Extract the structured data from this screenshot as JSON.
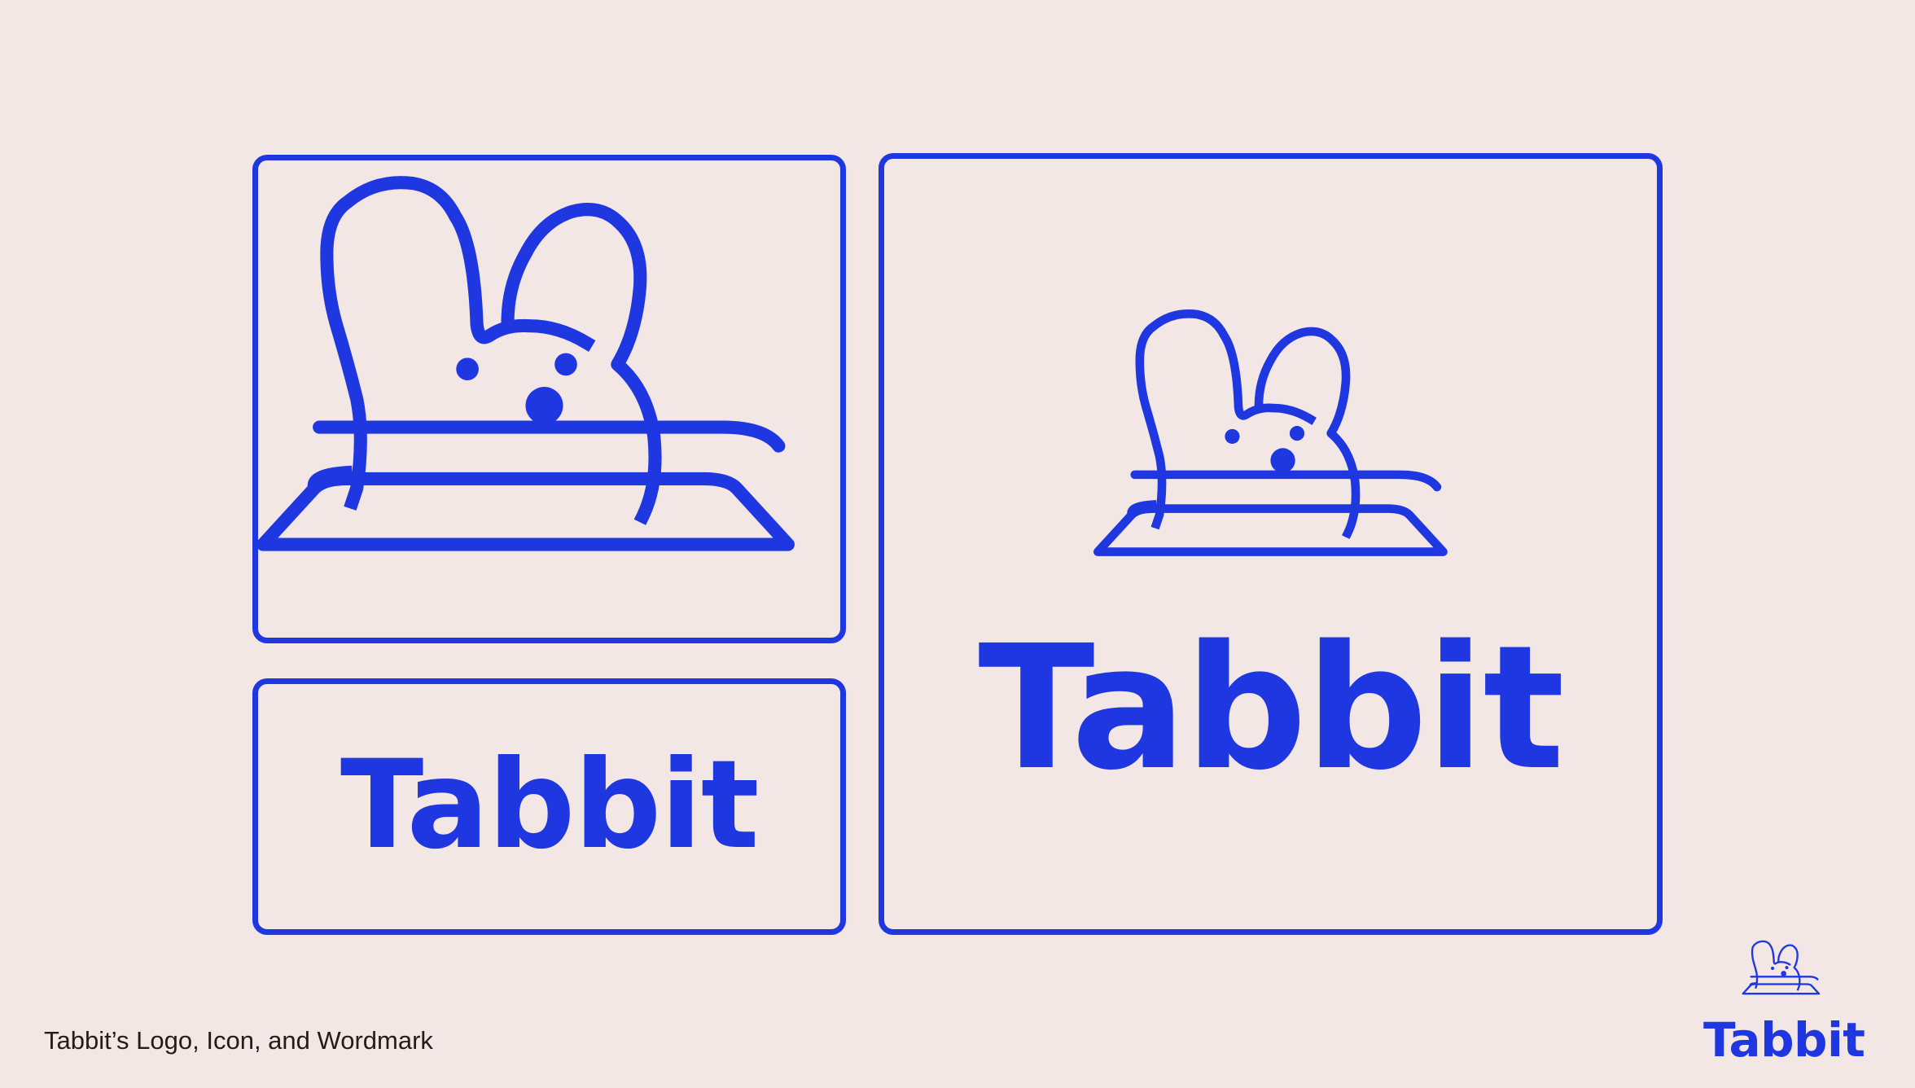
{
  "brand": {
    "name": "Tabbit",
    "color": "#1f37e0",
    "background": "#f3e7e5"
  },
  "panels": {
    "icon": {
      "icon": "rabbit-in-box-icon"
    },
    "wordmark": {
      "text": "Tabbit"
    },
    "logo": {
      "icon": "rabbit-in-box-icon",
      "text": "Tabbit"
    }
  },
  "corner_logo": {
    "icon": "rabbit-in-box-icon",
    "text": "Tabbit"
  },
  "caption": "Tabbit’s Logo, Icon, and Wordmark"
}
